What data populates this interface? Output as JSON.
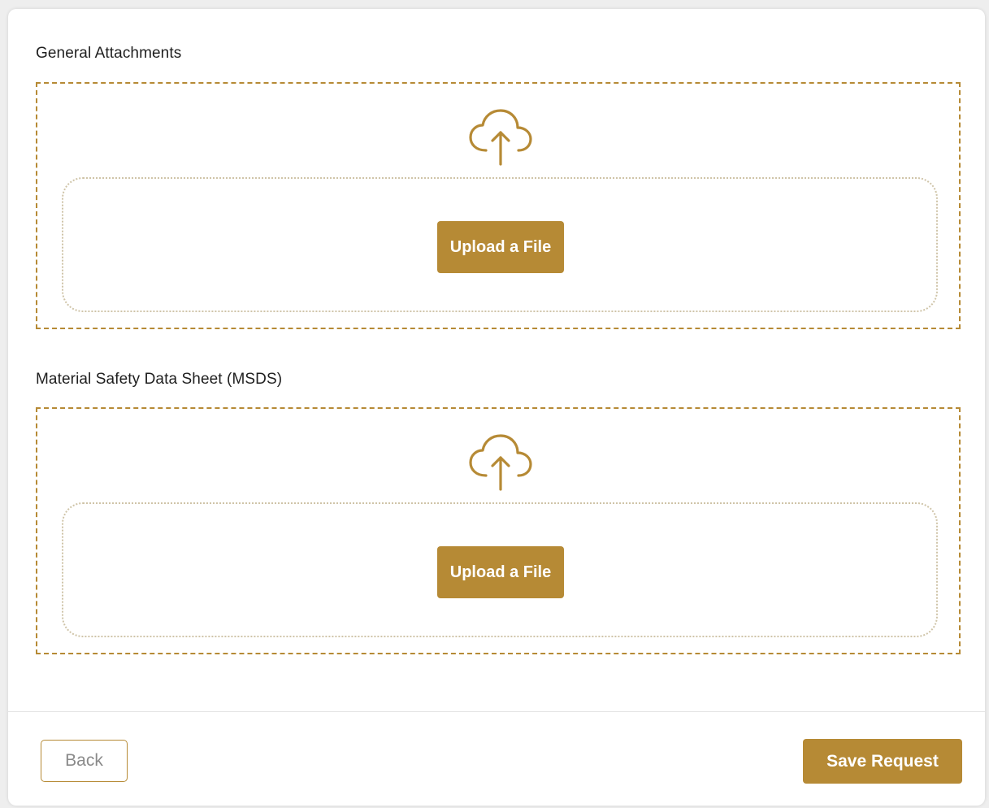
{
  "sections": [
    {
      "title": "General Attachments",
      "upload_label": "Upload a File",
      "icon": "cloud-upload-icon"
    },
    {
      "title": "Material Safety Data Sheet (MSDS)",
      "upload_label": "Upload a File",
      "icon": "cloud-upload-icon"
    }
  ],
  "footer": {
    "back_label": "Back",
    "save_label": "Save Request"
  },
  "colors": {
    "accent": "#b68a35",
    "inner_border": "#cfc4a8",
    "back_text": "#8a8a8a"
  }
}
